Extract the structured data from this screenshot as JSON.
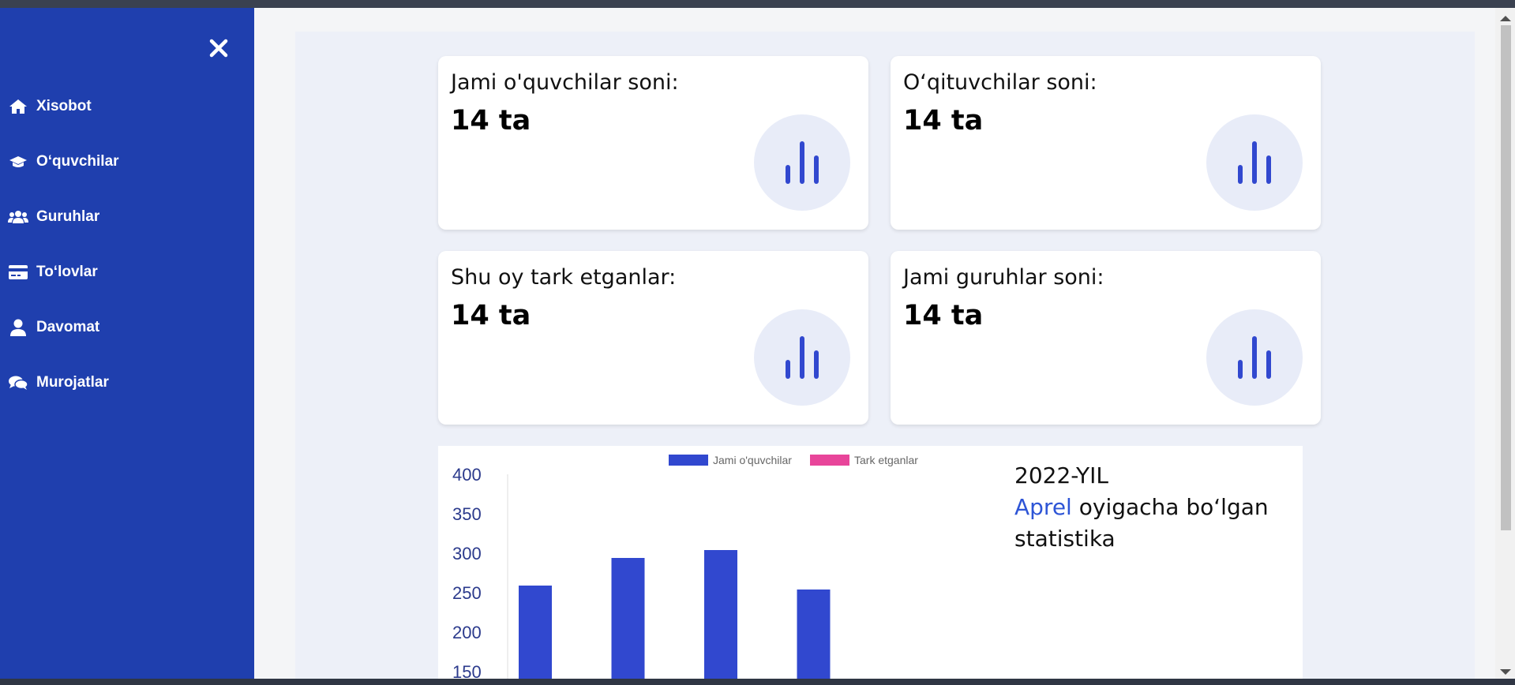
{
  "sidebar": {
    "items": [
      {
        "label": "Xisobot",
        "icon": "home-icon"
      },
      {
        "label": "O‘quvchilar",
        "icon": "graduation-cap-icon"
      },
      {
        "label": "Guruhlar",
        "icon": "users-icon"
      },
      {
        "label": "To‘lovlar",
        "icon": "credit-card-icon"
      },
      {
        "label": "Davomat",
        "icon": "user-icon"
      },
      {
        "label": "Murojatlar",
        "icon": "comments-icon"
      }
    ]
  },
  "cards": [
    {
      "title": "Jami o'quvchilar soni:",
      "value": "14 ta"
    },
    {
      "title": "O‘qituvchilar soni:",
      "value": "14 ta"
    },
    {
      "title": "Shu oy tark etganlar:",
      "value": "14 ta"
    },
    {
      "title": "Jami guruhlar soni:",
      "value": "14 ta"
    }
  ],
  "stats": {
    "year": "2022-YIL",
    "month": "Aprel",
    "rest": "oyigacha bo‘lgan statistika"
  },
  "colors": {
    "sidebar": "#1f3fae",
    "accent": "#3148cf",
    "series_2": "#e8459a"
  },
  "chart_data": {
    "type": "bar",
    "series": [
      {
        "name": "Jami o'quvchilar",
        "color": "#3148cf",
        "values": [
          260,
          295,
          305,
          255
        ]
      },
      {
        "name": "Tark etganlar",
        "color": "#e8459a",
        "values": []
      }
    ],
    "yticks": [
      400,
      350,
      300,
      250,
      200,
      150
    ],
    "ylim": [
      150,
      400
    ],
    "legend_position": "top"
  }
}
